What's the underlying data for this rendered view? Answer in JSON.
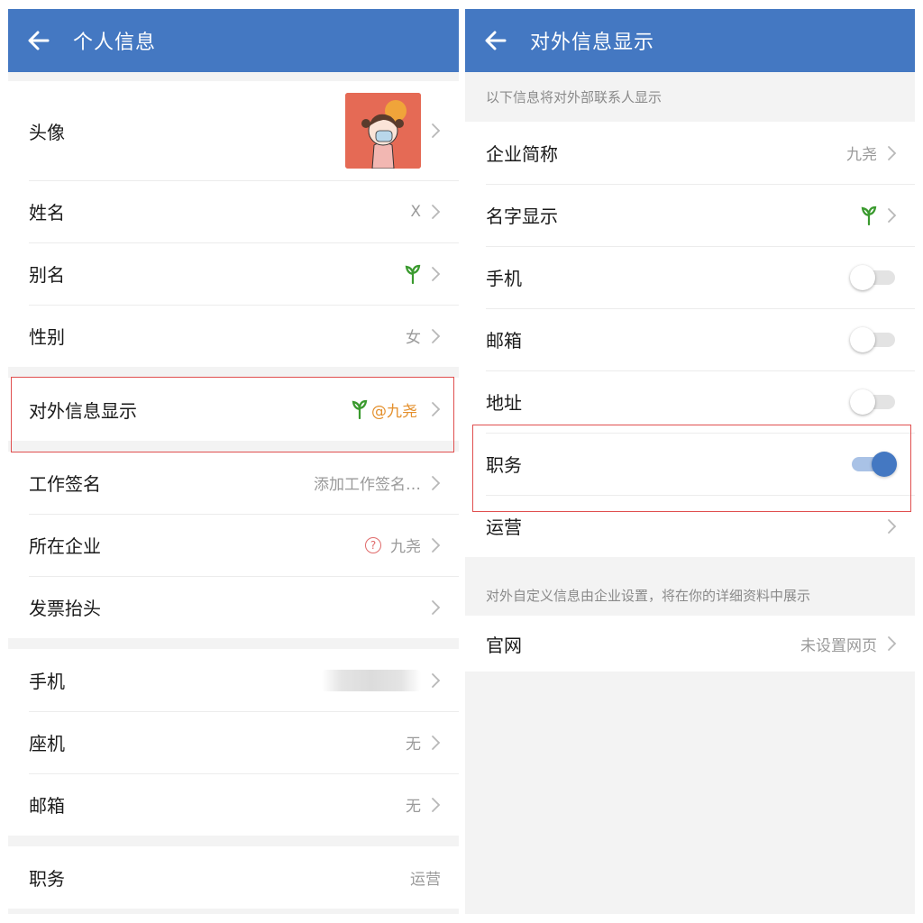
{
  "left": {
    "title": "个人信息",
    "rows": {
      "avatar": {
        "label": "头像"
      },
      "name": {
        "label": "姓名",
        "value": "X"
      },
      "alias": {
        "label": "别名"
      },
      "gender": {
        "label": "性别",
        "value": "女"
      },
      "external": {
        "label": "对外信息显示",
        "value": "@九尧"
      },
      "signature": {
        "label": "工作签名",
        "value": "添加工作签名…"
      },
      "company": {
        "label": "所在企业",
        "value": "九尧"
      },
      "invoice": {
        "label": "发票抬头"
      },
      "phone": {
        "label": "手机"
      },
      "landline": {
        "label": "座机",
        "value": "无"
      },
      "email": {
        "label": "邮箱",
        "value": "无"
      },
      "position": {
        "label": "职务",
        "value": "运营"
      }
    }
  },
  "right": {
    "title": "对外信息显示",
    "note_top": "以下信息将对外部联系人显示",
    "rows": {
      "company_short": {
        "label": "企业简称",
        "value": "九尧"
      },
      "name_display": {
        "label": "名字显示"
      },
      "phone": {
        "label": "手机",
        "on": false
      },
      "email": {
        "label": "邮箱",
        "on": false
      },
      "address": {
        "label": "地址",
        "on": false
      },
      "position": {
        "label": "职务",
        "on": true
      },
      "operation": {
        "label": "运营"
      }
    },
    "note_custom": "对外自定义信息由企业设置，将在你的详细资料中展示",
    "website": {
      "label": "官网",
      "value": "未设置网页"
    }
  },
  "icons": {
    "back": "arrow-left-icon",
    "chevron": "chevron-right-icon",
    "sprout": "sprout-icon",
    "question": "question-circle-icon"
  },
  "colors": {
    "appbar": "#4478c2",
    "highlight": "#e04f4f",
    "sprout": "#3a9a2e",
    "orange_text": "#e4902d",
    "toggle_on": "#4478c2"
  }
}
